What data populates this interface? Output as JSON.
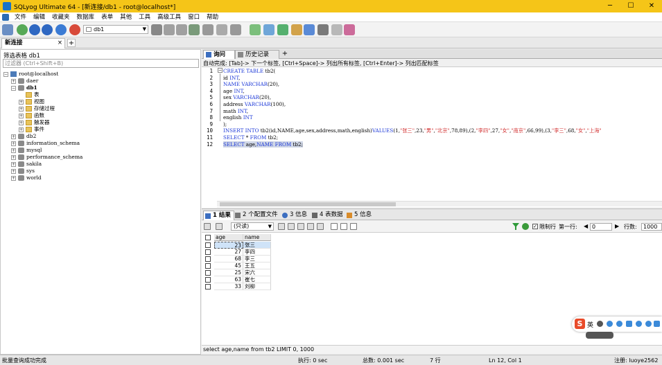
{
  "window": {
    "title": "SQLyog Ultimate 64 - [新连接/db1 - root@localhost*]",
    "controls": [
      "─",
      "☐",
      "✕"
    ]
  },
  "menu": [
    "文件",
    "编辑",
    "收藏夹",
    "数据库",
    "表单",
    "其他",
    "工具",
    "高级工具",
    "窗口",
    "帮助"
  ],
  "toolbar": {
    "db_selected": "db1"
  },
  "connection_tab": {
    "label": "新连接",
    "close": "×",
    "add": "+"
  },
  "object_browser": {
    "filter_label": "筛选表格 db1",
    "filter_placeholder": "过滤器 (Ctrl+Shift+B)",
    "tree": [
      {
        "label": "root@localhost",
        "level": 0,
        "expander": "−",
        "icon": "server"
      },
      {
        "label": "daer",
        "level": 1,
        "expander": "+",
        "icon": "db"
      },
      {
        "label": "db1",
        "level": 1,
        "expander": "−",
        "icon": "db",
        "bold": true
      },
      {
        "label": "表",
        "level": 2,
        "expander": "",
        "icon": "folder"
      },
      {
        "label": "视图",
        "level": 2,
        "expander": "+",
        "icon": "folder"
      },
      {
        "label": "存储过程",
        "level": 2,
        "expander": "+",
        "icon": "folder"
      },
      {
        "label": "函数",
        "level": 2,
        "expander": "+",
        "icon": "folder"
      },
      {
        "label": "触发器",
        "level": 2,
        "expander": "+",
        "icon": "folder"
      },
      {
        "label": "事件",
        "level": 2,
        "expander": "+",
        "icon": "folder"
      },
      {
        "label": "db2",
        "level": 1,
        "expander": "+",
        "icon": "db"
      },
      {
        "label": "information_schema",
        "level": 1,
        "expander": "+",
        "icon": "db"
      },
      {
        "label": "mysql",
        "level": 1,
        "expander": "+",
        "icon": "db"
      },
      {
        "label": "performance_schema",
        "level": 1,
        "expander": "+",
        "icon": "db"
      },
      {
        "label": "sakila",
        "level": 1,
        "expander": "+",
        "icon": "db"
      },
      {
        "label": "sys",
        "level": 1,
        "expander": "+",
        "icon": "db"
      },
      {
        "label": "world",
        "level": 1,
        "expander": "+",
        "icon": "db"
      }
    ]
  },
  "editor_tabs": [
    {
      "label": "询问",
      "active": true
    },
    {
      "label": "历史记录",
      "active": false
    }
  ],
  "editor_tab_add": "+",
  "autocomplete_hint": "自动完成: [Tab]-> 下一个标签, [Ctrl+Space]-> 列出所有标签, [Ctrl+Enter]-> 列出匹配标签",
  "code_lines": [
    {
      "n": "1",
      "segs": [
        [
          "kw",
          "CREATE TABLE "
        ],
        [
          "",
          "tb2("
        ]
      ]
    },
    {
      "n": "2",
      "segs": [
        [
          "",
          "id "
        ],
        [
          "kw",
          "INT"
        ],
        [
          "",
          ","
        ]
      ]
    },
    {
      "n": "3",
      "segs": [
        [
          "kw",
          "NAME VARCHAR"
        ],
        [
          "",
          "(20),"
        ]
      ]
    },
    {
      "n": "4",
      "segs": [
        [
          "",
          "age "
        ],
        [
          "kw",
          "INT"
        ],
        [
          "",
          ","
        ]
      ]
    },
    {
      "n": "5",
      "segs": [
        [
          "",
          "sex "
        ],
        [
          "kw",
          "VARCHAR"
        ],
        [
          "",
          "(20),"
        ]
      ]
    },
    {
      "n": "6",
      "segs": [
        [
          "",
          "address "
        ],
        [
          "kw",
          "VARCHAR"
        ],
        [
          "",
          "(100),"
        ]
      ]
    },
    {
      "n": "7",
      "segs": [
        [
          "",
          "math "
        ],
        [
          "kw",
          "INT"
        ],
        [
          "",
          ","
        ]
      ]
    },
    {
      "n": "8",
      "segs": [
        [
          "",
          "english "
        ],
        [
          "kw",
          "INT"
        ]
      ]
    },
    {
      "n": "9",
      "segs": [
        [
          "",
          ");"
        ]
      ]
    },
    {
      "n": "10",
      "segs": [
        [
          "kw",
          "INSERT INTO "
        ],
        [
          "",
          "tb2(id,NAME,age,sex,address,math,english)"
        ],
        [
          "kw",
          "VALUES"
        ],
        [
          "",
          "(1,"
        ],
        [
          "str",
          "\"张三\""
        ],
        [
          "",
          ",23,"
        ],
        [
          "str",
          "\"男\""
        ],
        [
          "",
          ","
        ],
        [
          "str",
          "\"北京\""
        ],
        [
          "",
          ",78,89),(2,"
        ],
        [
          "str",
          "\"李四\""
        ],
        [
          "",
          ",27,"
        ],
        [
          "str",
          "\"女\""
        ],
        [
          "",
          ","
        ],
        [
          "str",
          "\"南京\""
        ],
        [
          "",
          ",66,99),(3,"
        ],
        [
          "str",
          "\"李三\""
        ],
        [
          "",
          ",68,"
        ],
        [
          "str",
          "\"女\""
        ],
        [
          "",
          ","
        ],
        [
          "str",
          "\"上海\""
        ]
      ]
    },
    {
      "n": "11",
      "segs": [
        [
          "kw",
          "SELECT "
        ],
        [
          "",
          "* "
        ],
        [
          "kw",
          "FROM "
        ],
        [
          "",
          "tb2;"
        ]
      ]
    },
    {
      "n": "12",
      "segs": [
        [
          "kw",
          "SELECT "
        ],
        [
          "",
          "age,"
        ],
        [
          "kw",
          "NAME FROM "
        ],
        [
          "",
          "tb2;"
        ]
      ],
      "highlight": true
    }
  ],
  "result_tabs": [
    {
      "label": "1 结果",
      "active": true
    },
    {
      "label": "2 个配置文件",
      "active": false
    },
    {
      "label": "3 信息",
      "active": false
    },
    {
      "label": "4 表数据",
      "active": false
    },
    {
      "label": "5 信息",
      "active": false
    }
  ],
  "result_toolbar": {
    "mode": "(只读)",
    "limit_label": "限制行",
    "first_row_label": "第一行:",
    "first_row_value": "0",
    "rows_label": "行数:",
    "rows_value": "1000"
  },
  "result_grid": {
    "columns": [
      "age",
      "name"
    ],
    "rows": [
      {
        "age": "23",
        "name": "张三"
      },
      {
        "age": "27",
        "name": "李四"
      },
      {
        "age": "68",
        "name": "李三"
      },
      {
        "age": "45",
        "name": "王五"
      },
      {
        "age": "25",
        "name": "宋六"
      },
      {
        "age": "63",
        "name": "崔七"
      },
      {
        "age": "33",
        "name": "刘柳"
      }
    ]
  },
  "query_info": "select age,name from tb2 LIMIT 0, 1000",
  "status": {
    "left": "批量查询成功完成",
    "exec": "执行: 0 sec",
    "total": "总数: 0.001 sec",
    "rows": "7 行",
    "pos": "Ln 12, Col 1",
    "reg": "注册: luoye2562"
  },
  "ime": {
    "logo": "S",
    "lang": "英"
  },
  "colors": {
    "titlebar": "#f5c518",
    "keyword": "#1e3ad8",
    "string": "#d23030",
    "selection": "#cfe3f8"
  }
}
